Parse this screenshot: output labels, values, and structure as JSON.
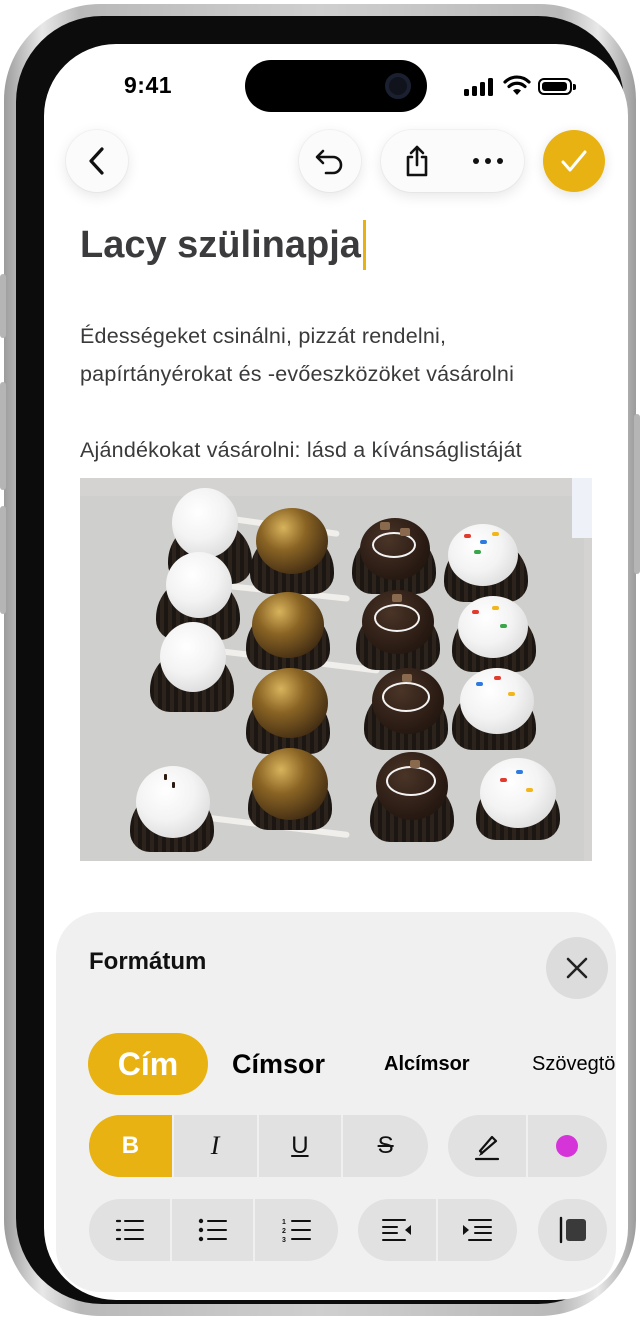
{
  "status_bar": {
    "time": "9:41"
  },
  "toolbar": {
    "back_icon": "chevron-left-icon",
    "undo_icon": "undo-icon",
    "share_icon": "share-icon",
    "more_icon": "ellipsis-icon",
    "done_icon": "checkmark-icon"
  },
  "note": {
    "title": "Lacy szülinapja",
    "paragraph1": "Édességeket csinálni, pizzát rendelni, papírtányérokat és -evőeszközöket vásárolni",
    "paragraph2": "Ajándékokat vásárolni: lásd a kívánságlistáját"
  },
  "format_panel": {
    "title": "Formátum",
    "text_styles": [
      "Cím",
      "Címsor",
      "Alcímsor",
      "Szövegtö"
    ],
    "selected_style": "Cím",
    "bold_label": "B",
    "italic_label": "I",
    "underline_label": "U",
    "strike_label": "S",
    "bold_active": true,
    "text_color": "#d535d8"
  },
  "colors": {
    "accent": "#e8b212"
  }
}
